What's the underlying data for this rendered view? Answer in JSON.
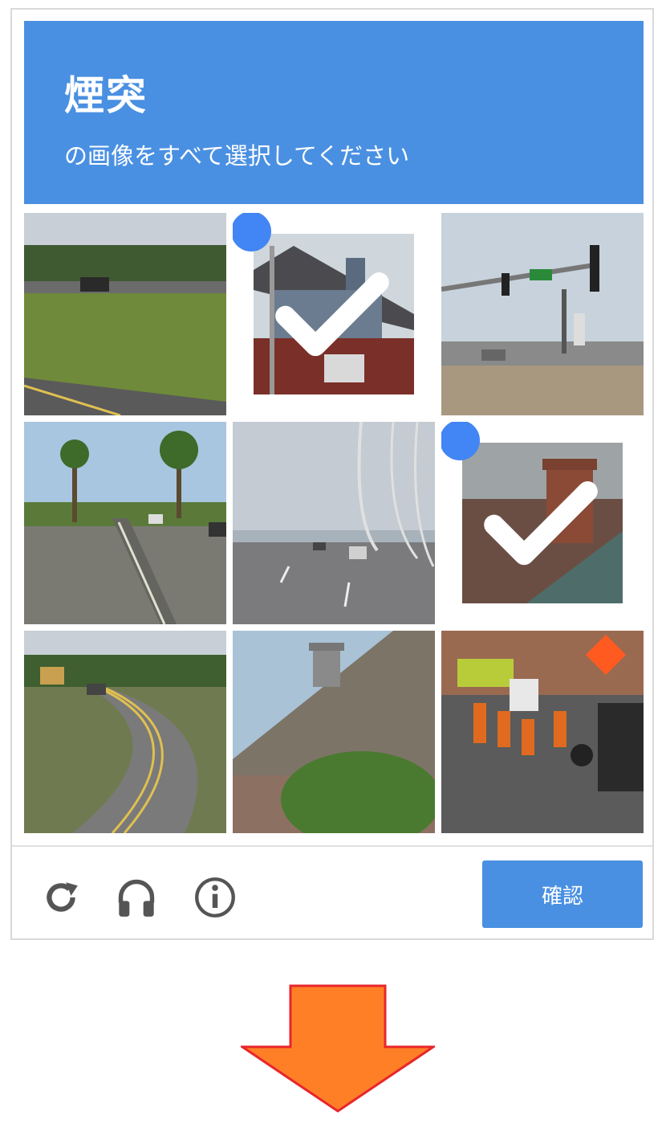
{
  "header": {
    "title": "煙突",
    "subtitle": "の画像をすべて選択してください"
  },
  "grid": {
    "tiles": [
      {
        "subject": "highway-grass",
        "selected": false
      },
      {
        "subject": "house-with-chimney",
        "selected": true
      },
      {
        "subject": "traffic-lights",
        "selected": false
      },
      {
        "subject": "palm-tree-street",
        "selected": false
      },
      {
        "subject": "bridge-road",
        "selected": false
      },
      {
        "subject": "roof-chimney",
        "selected": true
      },
      {
        "subject": "curved-road",
        "selected": false
      },
      {
        "subject": "roof-with-vent",
        "selected": false
      },
      {
        "subject": "construction-street",
        "selected": false
      }
    ]
  },
  "footer": {
    "icons": [
      "reload-icon",
      "headphones-icon",
      "info-icon"
    ],
    "verify_label": "確認"
  },
  "colors": {
    "accent": "#4a90e2",
    "check": "#4285f4",
    "arrow_fill": "#ff7f27",
    "arrow_stroke": "#e8252b"
  }
}
